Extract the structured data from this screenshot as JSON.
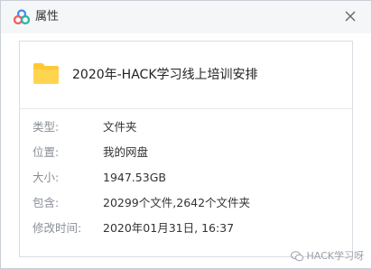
{
  "dialog": {
    "title": "属性",
    "app_icon": "baidu-netdisk-cloud-icon",
    "close_icon": "close-icon"
  },
  "file": {
    "icon": "folder-icon",
    "name": "2020年-HACK学习线上培训安排"
  },
  "properties": [
    {
      "label": "类型:",
      "value": "文件夹"
    },
    {
      "label": "位置:",
      "value": "我的网盘"
    },
    {
      "label": "大小:",
      "value": "1947.53GB"
    },
    {
      "label": "包含:",
      "value": "20299个文件,2642个文件夹"
    },
    {
      "label": "修改时间:",
      "value": "2020年01月31日, 16:37"
    }
  ],
  "watermark": {
    "icon": "wechat-icon",
    "text": "HACK学习呀"
  },
  "colors": {
    "folder": "#ffc935",
    "titlebar_bg": "#f5f6f8",
    "label": "#8a8f97",
    "border": "#d9dde3"
  }
}
